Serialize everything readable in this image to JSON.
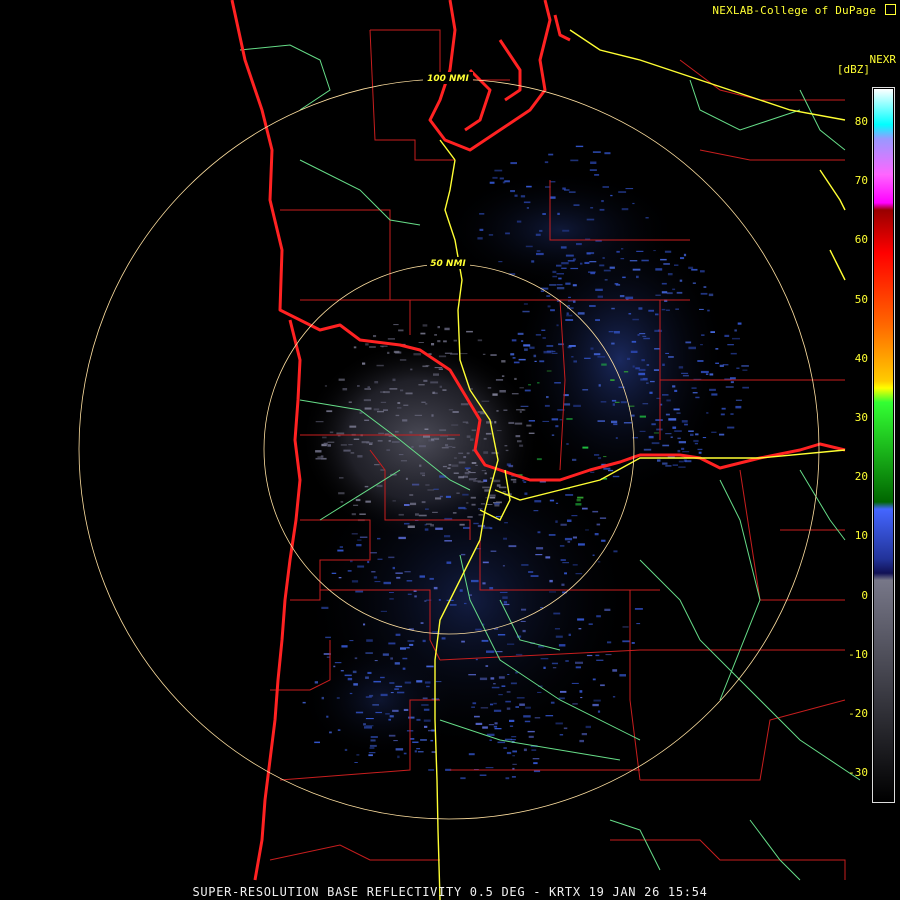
{
  "header": {
    "credit": "NEXLAB-College of DuPage",
    "credit_link_icon": "external-link-icon",
    "product": "NEXR",
    "units": "[dBZ]"
  },
  "range_rings": [
    {
      "label": "100 NMI"
    },
    {
      "label": "50 NMI"
    }
  ],
  "color_scale": {
    "ticks": [
      "80",
      "70",
      "60",
      "50",
      "40",
      "30",
      "20",
      "10",
      "0",
      "-10",
      "-20",
      "-30"
    ],
    "colors": {
      "background": "#000000",
      "ring": "#ffe0a0",
      "highways": "#ffff33",
      "state_border": "#ff2222",
      "county_lines": "#c81e1e",
      "rivers": "#66dd88"
    }
  },
  "footer": {
    "caption": "SUPER-RESOLUTION BASE REFLECTIVITY 0.5 DEG - KRTX 19 JAN 26 15:54"
  }
}
